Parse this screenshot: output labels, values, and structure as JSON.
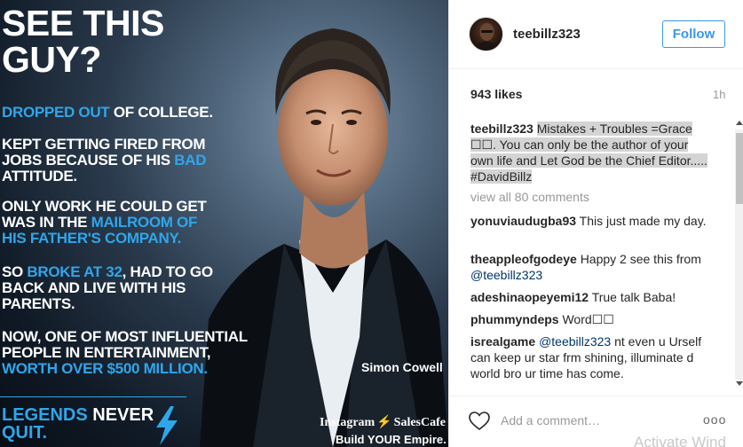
{
  "poster": {
    "headline_line1": "SEE THIS",
    "headline_line2": "GUY?",
    "p1_hl": "DROPPED OUT",
    "p1_rest": " OF COLLEGE.",
    "p2_line1": "KEPT GETTING FIRED FROM",
    "p2_line2a": "JOBS BECAUSE OF HIS ",
    "p2_line2b": "BAD",
    "p2_line3": "ATTITUDE.",
    "p3_line1": "ONLY WORK HE COULD GET",
    "p3_line2a": "WAS IN THE ",
    "p3_line2b": "MAILROOM OF",
    "p3_line3": "HIS FATHER'S COMPANY.",
    "p4_line1a": "SO ",
    "p4_line1b": "BROKE AT 32",
    "p4_line1c": ", HAD TO GO",
    "p4_line2": "BACK AND LIVE WITH HIS",
    "p4_line3": "PARENTS.",
    "p5_line1": "NOW, ONE OF MOST INFLUENTIAL",
    "p5_line2": "PEOPLE IN ENTERTAINMENT,",
    "p5_line3": "WORTH OVER $500 MILLION.",
    "caption_name": "Simon Cowell",
    "legends_a": "LEGENDS",
    "legends_b": " NEVER",
    "legends_c": "QUIT.",
    "brand_a": "Instagram",
    "brand_b": "SalesCafe",
    "brand_sub": "Build YOUR Empire."
  },
  "post": {
    "username": "teebillz323",
    "follow_label": "Follow",
    "likes": "943 likes",
    "time": "1h",
    "caption_user": "teebillz323",
    "caption_text": "Mistakes + Troubles =Grace ☐☐. You can only be the author of your own life and Let God be the Chief Editor..... #DavidBillz",
    "view_all": "view all 80 comments",
    "comments": [
      {
        "user": "yonuviaudugba93",
        "text": "This just made my day."
      },
      {
        "user": "theappleofgodeye",
        "text": "Happy 2 see this from ",
        "mention": "@teebillz323"
      },
      {
        "user": "adeshinaopeyemi12",
        "text": "True talk Baba!"
      },
      {
        "user": "phummyndeps",
        "text": "Word☐☐"
      },
      {
        "user": "isrealgame",
        "mention": "@teebillz323",
        "text": " nt even u Urself can keep ur star frm shining, illuminate d world bro ur time has come."
      }
    ],
    "add_comment_placeholder": "Add a comment…",
    "more_label": "ooo"
  },
  "watermark": "Activate Wind",
  "colors": {
    "accent": "#3897f0",
    "poster_highlight": "#2fa6ea",
    "mention": "#003569"
  }
}
